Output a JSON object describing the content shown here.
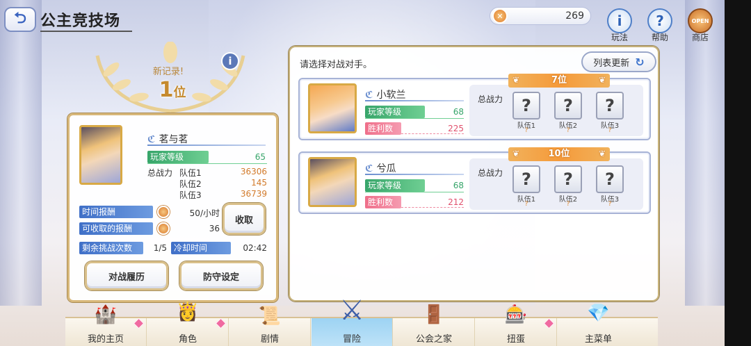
{
  "header": {
    "back_glyph": "⮌",
    "title": "公主竞技场",
    "currency_value": "269",
    "currency_glyph": "✕",
    "help_buttons": [
      {
        "label": "玩法",
        "glyph": "i"
      },
      {
        "label": "帮助",
        "glyph": "?"
      },
      {
        "label": "商店",
        "glyph": "OPEN"
      }
    ]
  },
  "record": {
    "new_record": "新记录!",
    "rank_number": "1",
    "rank_unit": "位",
    "info_glyph": "i"
  },
  "player": {
    "name": "茗与茗",
    "level_label": "玩家等级",
    "level": "65",
    "power_label": "总战力",
    "teams": [
      {
        "label": "队伍1",
        "value": "36306"
      },
      {
        "label": "队伍2",
        "value": "145"
      },
      {
        "label": "队伍3",
        "value": "36739"
      }
    ]
  },
  "rewards": {
    "time_reward_label": "时间报酬",
    "time_reward_value": "50/小时",
    "claimable_label": "可收取的报酬",
    "claimable_value": "36",
    "collect_button": "收取",
    "remaining_label": "剩余挑战次数",
    "remaining_value": "1/5",
    "cooldown_label": "冷却时间",
    "cooldown_value": "02:42"
  },
  "actions": {
    "history_button": "对战履历",
    "defense_button": "防守设定"
  },
  "opponents_panel": {
    "title": "请选择对战对手。",
    "refresh_button": "列表更新",
    "refresh_glyph": "↻",
    "power_label": "总战力",
    "slot_glyph": "?",
    "slot_question": "?",
    "team_labels": [
      "队伍1",
      "队伍2",
      "队伍3"
    ],
    "level_label": "玩家等级",
    "wins_label": "胜利数",
    "opponents": [
      {
        "name": "小软兰",
        "level": "68",
        "wins": "225",
        "rank": "7位"
      },
      {
        "name": "兮瓜",
        "level": "68",
        "wins": "212",
        "rank": "10位"
      }
    ]
  },
  "nav": {
    "items": [
      {
        "label": "我的主页",
        "icon": "🏰"
      },
      {
        "label": "角色",
        "icon": "👸"
      },
      {
        "label": "剧情",
        "icon": "📜"
      },
      {
        "label": "冒险",
        "icon": "⚔"
      },
      {
        "label": "公会之家",
        "icon": "🚪"
      },
      {
        "label": "扭蛋",
        "icon": "🎰"
      },
      {
        "label": "主菜单",
        "icon": "💎"
      }
    ]
  },
  "colors": {
    "accent_blue": "#3f6fc7",
    "level_green": "#37a56a",
    "wins_red": "#ef6f8a",
    "rank_orange": "#f59a3a",
    "frame_gold": "#d8b87a"
  }
}
